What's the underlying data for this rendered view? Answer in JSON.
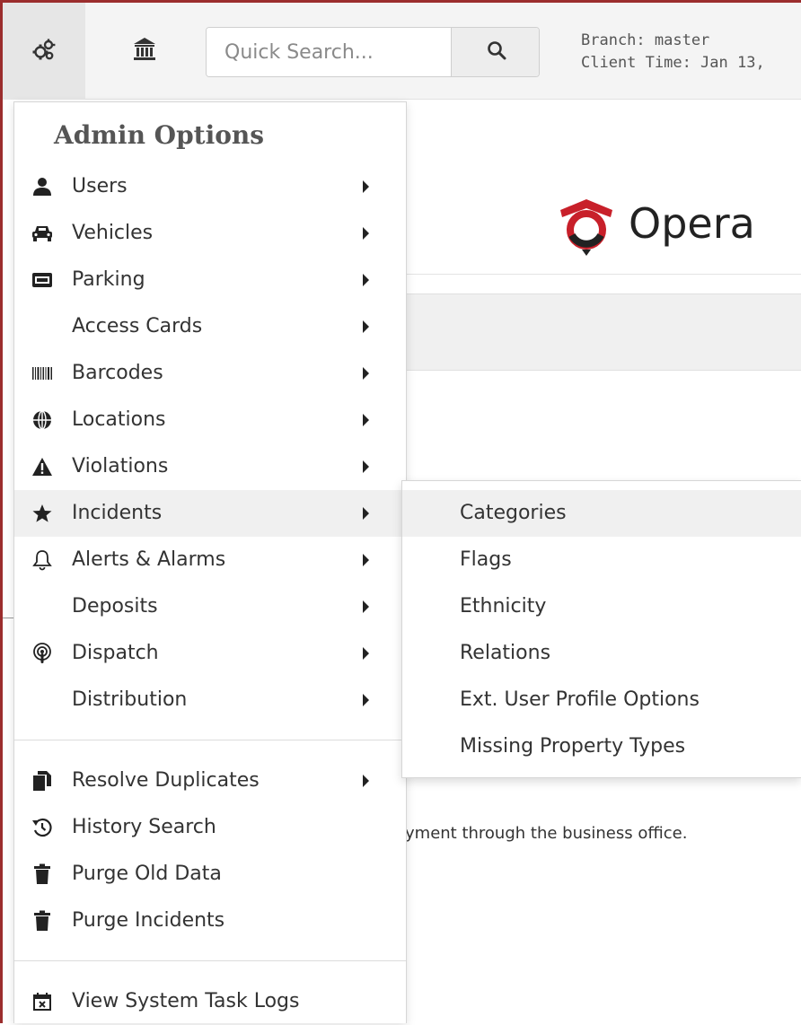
{
  "topbar": {
    "search_placeholder": "Quick Search...",
    "branch_text": "Branch: master",
    "client_time_text": "Client Time: Jan 13,"
  },
  "page": {
    "brand_text": "Opera",
    "notice_text": "ıyment through the business office."
  },
  "admin_menu": {
    "title": "Admin Options",
    "items": [
      {
        "label": "Users",
        "icon": "user-icon"
      },
      {
        "label": "Vehicles",
        "icon": "car-icon"
      },
      {
        "label": "Parking",
        "icon": "parking-icon"
      },
      {
        "label": "Access Cards",
        "icon": ""
      },
      {
        "label": "Barcodes",
        "icon": "barcode-icon"
      },
      {
        "label": "Locations",
        "icon": "globe-icon"
      },
      {
        "label": "Violations",
        "icon": "warning-icon"
      },
      {
        "label": "Incidents",
        "icon": "star-icon",
        "active": true
      },
      {
        "label": "Alerts & Alarms",
        "icon": "bell-icon"
      },
      {
        "label": "Deposits",
        "icon": ""
      },
      {
        "label": "Dispatch",
        "icon": "podcast-icon"
      },
      {
        "label": "Distribution",
        "icon": ""
      }
    ],
    "tools": [
      {
        "label": "Resolve Duplicates",
        "icon": "copy-icon"
      },
      {
        "label": "History Search",
        "icon": "history-icon"
      },
      {
        "label": "Purge Old Data",
        "icon": "trash-icon"
      },
      {
        "label": "Purge Incidents",
        "icon": "trash-icon"
      }
    ],
    "system": [
      {
        "label": "View System Task Logs",
        "icon": "calendar-x-icon"
      }
    ]
  },
  "incidents_submenu": {
    "items": [
      {
        "label": "Categories",
        "active": true
      },
      {
        "label": "Flags"
      },
      {
        "label": "Ethnicity"
      },
      {
        "label": "Relations"
      },
      {
        "label": "Ext. User Profile Options"
      },
      {
        "label": "Missing Property Types"
      }
    ]
  },
  "colors": {
    "frame_border": "#9b2d2d",
    "logo_red": "#c8202a",
    "hover_bg": "#f0f0f0"
  }
}
